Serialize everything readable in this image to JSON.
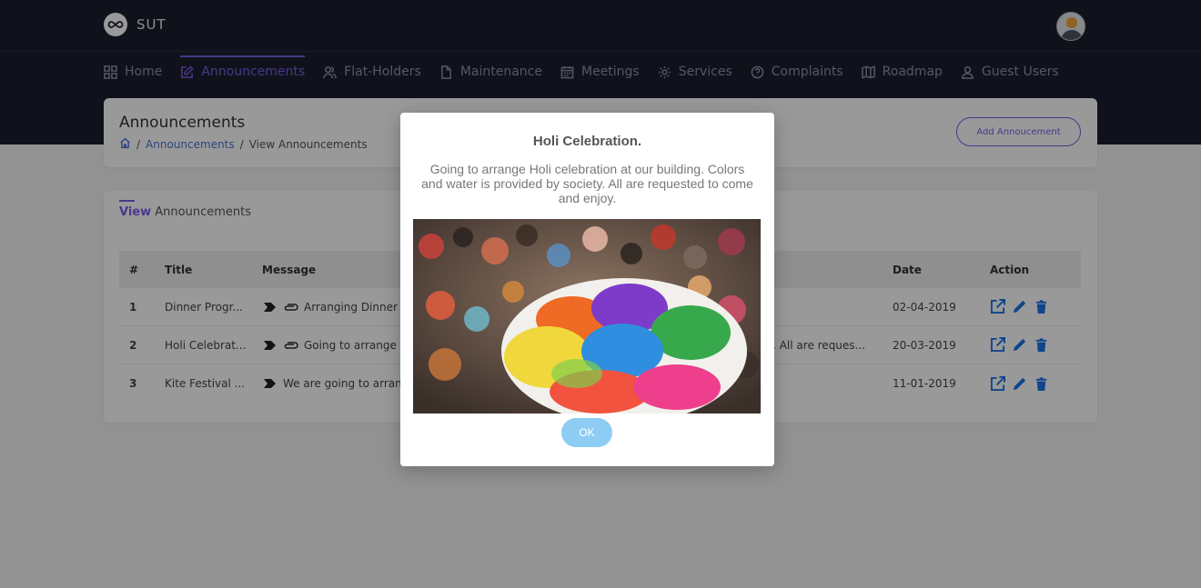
{
  "brand": {
    "name": "SUT"
  },
  "nav": [
    {
      "label": "Home",
      "icon": "grid-icon"
    },
    {
      "label": "Announcements",
      "icon": "edit-icon",
      "active": true
    },
    {
      "label": "Flat-Holders",
      "icon": "users-icon"
    },
    {
      "label": "Maintenance",
      "icon": "file-icon"
    },
    {
      "label": "Meetings",
      "icon": "calendar-icon"
    },
    {
      "label": "Services",
      "icon": "gear-icon"
    },
    {
      "label": "Complaints",
      "icon": "help-circle-icon"
    },
    {
      "label": "Roadmap",
      "icon": "map-icon"
    },
    {
      "label": "Guest Users",
      "icon": "user-icon"
    }
  ],
  "page": {
    "title": "Announcements",
    "breadcrumb": {
      "link": "Announcements",
      "current": "View Announcements"
    },
    "add_button": "Add Annoucement"
  },
  "list": {
    "tab_bold": "View",
    "tab_rest": "Announcements",
    "headers": {
      "num": "#",
      "title": "Title",
      "message": "Message",
      "date": "Date",
      "action": "Action"
    },
    "rows": [
      {
        "num": "1",
        "title": "Dinner Progr...",
        "message": "Arranging Dinner",
        "message_tail": "",
        "date": "02-04-2019",
        "attachment": true
      },
      {
        "num": "2",
        "title": "Holi Celebrat...",
        "message": "Going to arrange",
        "message_tail": "ty. All are reques...",
        "date": "20-03-2019",
        "attachment": true
      },
      {
        "num": "3",
        "title": "Kite Festival ...",
        "message": "We are going to arran",
        "message_tail": "",
        "date": "11-01-2019",
        "attachment": false
      }
    ]
  },
  "modal": {
    "title": "Holi Celebration.",
    "text": "Going to arrange Holi celebration at our building. Colors and water is provided by society. All are requested to come and enjoy.",
    "ok_label": "OK"
  },
  "colors": {
    "accent": "#7b5ce6",
    "link": "#4a77d6",
    "action_icon": "#1a73e8",
    "ok_button": "#8ecdf3",
    "header_bg": "#1c1f2e"
  }
}
